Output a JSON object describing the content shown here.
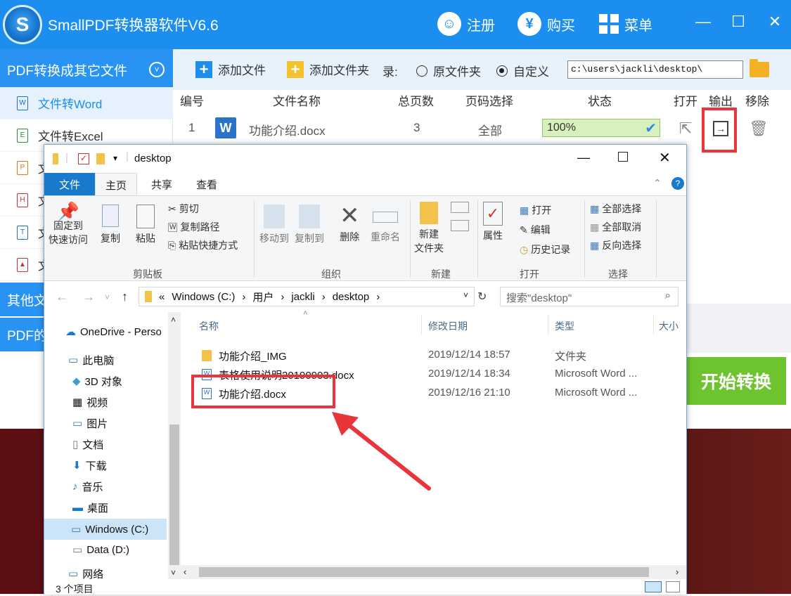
{
  "app": {
    "title": "SmallPDF转换器软件V6.6",
    "logo_letter": "S",
    "register": "注册",
    "buy": "购买",
    "menu": "菜单",
    "minimize": "—",
    "maximize": "☐",
    "close": "✕"
  },
  "sidebar": {
    "header1": "PDF转换成其它文件",
    "items": [
      {
        "label": "文件转Word",
        "icon": "W"
      },
      {
        "label": "文件转Excel",
        "icon": "E"
      },
      {
        "label": "文",
        "icon": "P"
      },
      {
        "label": "文",
        "icon": "H"
      },
      {
        "label": "文",
        "icon": "T"
      },
      {
        "label": "文",
        "icon": "▲"
      }
    ],
    "header2": "其他文",
    "header3": "PDF的"
  },
  "toolbar": {
    "add_file": "添加文件",
    "add_folder": "添加文件夹",
    "dir_label": "录:",
    "opt_source": "原文件夹",
    "opt_custom": "自定义",
    "path": "c:\\users\\jackli\\desktop\\"
  },
  "table": {
    "headers": {
      "num": "编号",
      "name": "文件名称",
      "pages": "总页数",
      "range": "页码选择",
      "status": "状态",
      "open": "打开",
      "output": "输出",
      "remove": "移除"
    },
    "rows": [
      {
        "num": "1",
        "icon": "W",
        "name": "功能介绍.docx",
        "pages": "3",
        "range": "全部",
        "progress": "100%",
        "progress_value": 1.0
      }
    ]
  },
  "convert_button": "开始转换",
  "explorer": {
    "title": "desktop",
    "tabs": {
      "file": "文件",
      "home": "主页",
      "share": "共享",
      "view": "查看"
    },
    "ribbon": {
      "pin": "固定到\n快速访问",
      "pin1": "固定到",
      "pin2": "快速访问",
      "copy": "复制",
      "paste": "粘贴",
      "cut": "剪切",
      "copy_path": "复制路径",
      "paste_shortcut": "粘贴快捷方式",
      "group_clipboard": "剪贴板",
      "move_to": "移动到",
      "copy_to": "复制到",
      "delete": "删除",
      "rename": "重命名",
      "group_organize": "组织",
      "new_folder1": "新建",
      "new_folder2": "文件夹",
      "group_new": "新建",
      "properties": "属性",
      "open": "打开",
      "edit": "编辑",
      "history": "历史记录",
      "group_open": "打开",
      "select_all": "全部选择",
      "select_none": "全部取消",
      "invert": "反向选择",
      "group_select": "选择"
    },
    "address": {
      "prefix": "«",
      "parts": [
        "Windows (C:)",
        "用户",
        "jackli",
        "desktop"
      ]
    },
    "search_placeholder": "搜索\"desktop\"",
    "nav": {
      "onedrive": "OneDrive - Perso",
      "this_pc": "此电脑",
      "obj3d": "3D 对象",
      "video": "视频",
      "pictures": "图片",
      "documents": "文档",
      "downloads": "下载",
      "music": "音乐",
      "desktop": "桌面",
      "windows_c": "Windows (C:)",
      "data_d": "Data (D:)",
      "network": "网络"
    },
    "columns": {
      "name": "名称",
      "date": "修改日期",
      "type": "类型",
      "size": "大小"
    },
    "files": [
      {
        "name": "功能介绍_IMG",
        "date": "2019/12/14 18:57",
        "type": "文件夹"
      },
      {
        "name": "表格使用说明20190903.docx",
        "date": "2019/12/14 18:34",
        "type": "Microsoft Word ..."
      },
      {
        "name": "功能介绍.docx",
        "date": "2019/12/16 21:10",
        "type": "Microsoft Word ..."
      }
    ],
    "status": "3 个项目"
  },
  "colors": {
    "brand": "#1b8ef0",
    "highlight": "#e8343a",
    "convert": "#6dc42e"
  }
}
